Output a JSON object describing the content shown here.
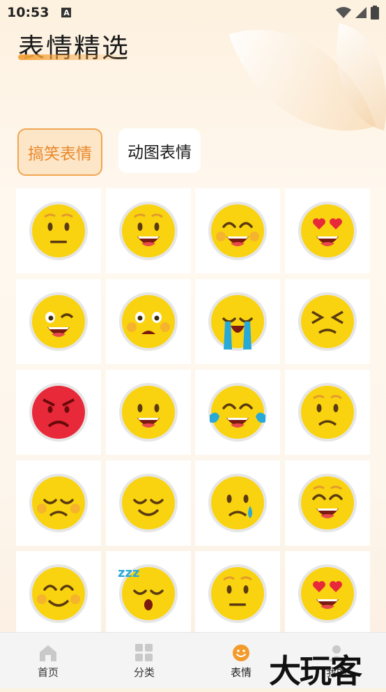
{
  "status_bar": {
    "time": "10:53",
    "a_badge": "A"
  },
  "page": {
    "title": "表情精选"
  },
  "tabs": [
    {
      "label": "搞笑表情",
      "selected": true
    },
    {
      "label": "动图表情",
      "selected": false
    }
  ],
  "emojis": [
    "neutral-face-icon",
    "smiling-face-icon",
    "grinning-face-icon",
    "heart-eyes-face-icon",
    "winking-face-icon",
    "surprised-face-icon",
    "loudly-crying-face-icon",
    "persevering-face-icon",
    "angry-red-face-icon",
    "happy-face-icon",
    "tears-of-joy-face-icon",
    "slightly-frowning-face-icon",
    "unamused-face-icon",
    "relieved-face-icon",
    "crying-face-icon",
    "beaming-face-icon",
    "blushing-face-icon",
    "sleeping-face-icon",
    "neutral-face-icon",
    "heart-eyes-face-icon"
  ],
  "bottom_nav": [
    {
      "label": "首页",
      "icon": "home-icon"
    },
    {
      "label": "分类",
      "icon": "grid-icon"
    },
    {
      "label": "表情",
      "icon": "smile-icon",
      "active": true
    },
    {
      "label": "我的",
      "icon": "user-icon"
    }
  ],
  "watermark": "大玩客",
  "colors": {
    "accent": "#f1a551",
    "emoji_yellow": "#f9d30f",
    "angry_red": "#e8293a"
  }
}
